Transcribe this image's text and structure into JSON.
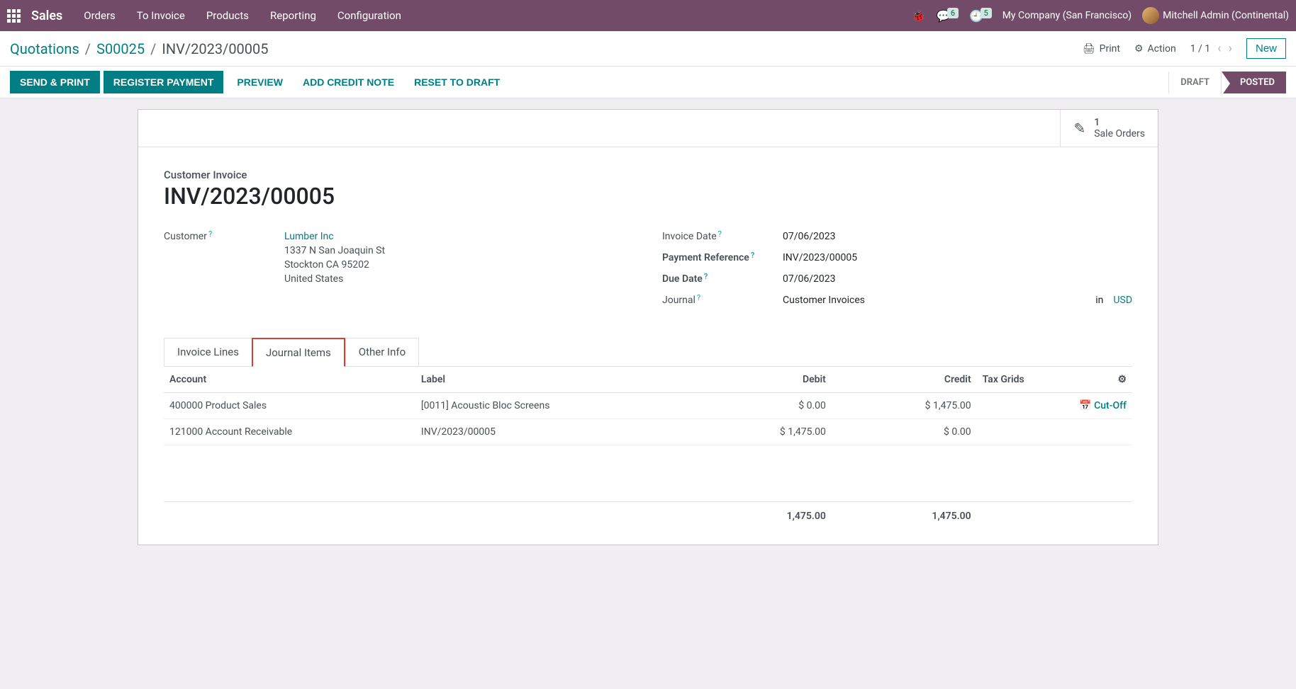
{
  "nav": {
    "brand": "Sales",
    "items": [
      "Orders",
      "To Invoice",
      "Products",
      "Reporting",
      "Configuration"
    ],
    "chat_badge": "6",
    "clock_badge": "5",
    "company": "My Company (San Francisco)",
    "user": "Mitchell Admin (Continental)"
  },
  "breadcrumb": {
    "l1": "Quotations",
    "l2": "S00025",
    "l3": "INV/2023/00005"
  },
  "secondary": {
    "print": "Print",
    "action": "Action",
    "pager": "1 / 1",
    "new": "New"
  },
  "actions": {
    "send_print": "SEND & PRINT",
    "register_payment": "REGISTER PAYMENT",
    "preview": "PREVIEW",
    "add_credit": "ADD CREDIT NOTE",
    "reset_draft": "RESET TO DRAFT",
    "status_draft": "DRAFT",
    "status_posted": "POSTED"
  },
  "stat": {
    "count": "1",
    "label": "Sale Orders"
  },
  "doc": {
    "type": "Customer Invoice",
    "title": "INV/2023/00005"
  },
  "fields": {
    "customer_label": "Customer",
    "customer_name": "Lumber Inc",
    "customer_addr1": "1337 N San Joaquin St",
    "customer_addr2": "Stockton CA 95202",
    "customer_addr3": "United States",
    "invoice_date_label": "Invoice Date",
    "invoice_date": "07/06/2023",
    "payment_ref_label": "Payment Reference",
    "payment_ref": "INV/2023/00005",
    "due_date_label": "Due Date",
    "due_date": "07/06/2023",
    "journal_label": "Journal",
    "journal_name": "Customer Invoices",
    "journal_in": "in",
    "journal_currency": "USD"
  },
  "tabs": {
    "invoice_lines": "Invoice Lines",
    "journal_items": "Journal Items",
    "other_info": "Other Info"
  },
  "table": {
    "h_account": "Account",
    "h_label": "Label",
    "h_debit": "Debit",
    "h_credit": "Credit",
    "h_taxgrids": "Tax Grids",
    "cutoff": "Cut-Off",
    "rows": [
      {
        "account": "400000 Product Sales",
        "label": "[0011] Acoustic Bloc Screens",
        "debit": "$ 0.00",
        "credit": "$ 1,475.00",
        "cutoff": true
      },
      {
        "account": "121000 Account Receivable",
        "label": "INV/2023/00005",
        "debit": "$ 1,475.00",
        "credit": "$ 0.00",
        "cutoff": false
      }
    ],
    "total_debit": "1,475.00",
    "total_credit": "1,475.00"
  }
}
